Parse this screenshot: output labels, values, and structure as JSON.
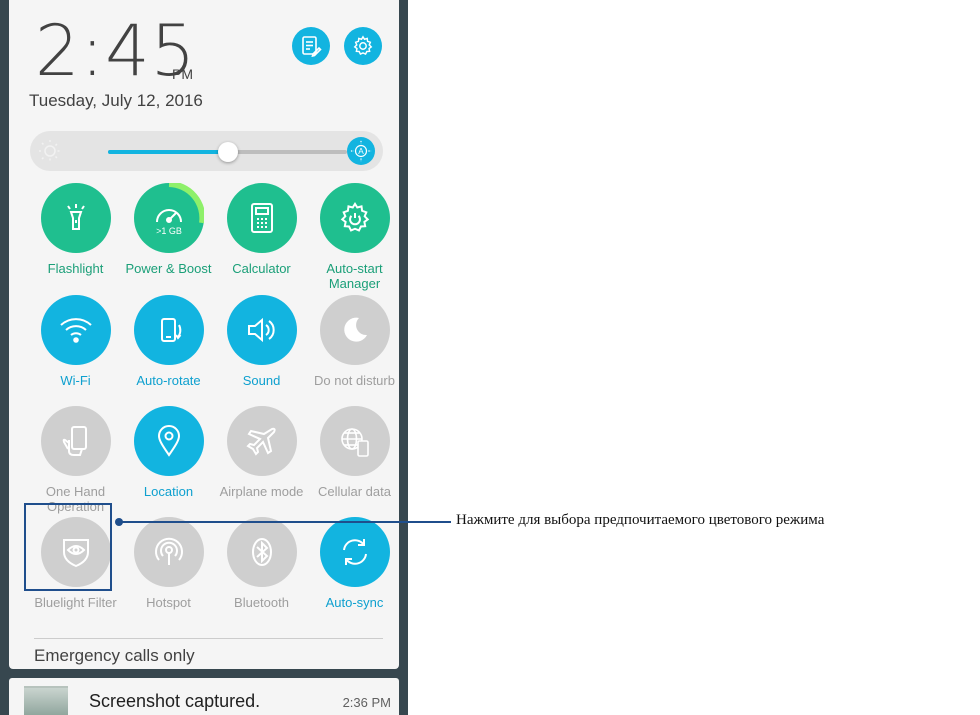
{
  "status": {
    "time": "2:45",
    "ampm": "PM",
    "date": "Tuesday, July 12, 2016"
  },
  "header_buttons": [
    {
      "icon": "notes-edit-icon"
    },
    {
      "icon": "settings-gear-icon"
    }
  ],
  "brightness": {
    "level": 0.5,
    "auto": true,
    "left_icon": "brightness-sun-icon",
    "right_icon": "auto-brightness-icon"
  },
  "tiles": [
    {
      "label": "Flashlight",
      "state": "on",
      "color": "#1fbf8f",
      "icon": "flashlight-icon"
    },
    {
      "label": "Power & Boost",
      "state": "on",
      "color": "#1fbf8f",
      "icon": "boost-speedometer-icon",
      "badge": ">1 GB"
    },
    {
      "label": "Calculator",
      "state": "on",
      "color": "#1fbf8f",
      "icon": "calculator-icon"
    },
    {
      "label": "Auto-start Manager",
      "state": "on",
      "color": "#1fbf8f",
      "icon": "gear-power-icon"
    },
    {
      "label": "Wi-Fi",
      "state": "on",
      "color": "#12b4e0",
      "icon": "wifi-icon"
    },
    {
      "label": "Auto-rotate",
      "state": "on",
      "color": "#12b4e0",
      "icon": "auto-rotate-icon"
    },
    {
      "label": "Sound",
      "state": "on",
      "color": "#12b4e0",
      "icon": "speaker-icon"
    },
    {
      "label": "Do not disturb",
      "state": "off",
      "color": "#cfcfcf",
      "icon": "moon-icon"
    },
    {
      "label": "One Hand Operation",
      "state": "off",
      "color": "#cfcfcf",
      "icon": "one-hand-icon"
    },
    {
      "label": "Location",
      "state": "on",
      "color": "#12b4e0",
      "icon": "location-pin-icon"
    },
    {
      "label": "Airplane mode",
      "state": "off",
      "color": "#cfcfcf",
      "icon": "airplane-icon"
    },
    {
      "label": "Cellular data",
      "state": "off",
      "color": "#cfcfcf",
      "icon": "globe-phone-icon"
    },
    {
      "label": "Bluelight Filter",
      "state": "off",
      "color": "#cfcfcf",
      "icon": "eye-shield-icon"
    },
    {
      "label": "Hotspot",
      "state": "off",
      "color": "#cfcfcf",
      "icon": "hotspot-icon"
    },
    {
      "label": "Bluetooth",
      "state": "off",
      "color": "#cfcfcf",
      "icon": "bluetooth-icon"
    },
    {
      "label": "Auto-sync",
      "state": "on",
      "color": "#12b4e0",
      "icon": "sync-icon"
    }
  ],
  "footer": {
    "emergency": "Emergency calls only"
  },
  "notification": {
    "title": "Screenshot captured.",
    "time": "2:36 PM"
  },
  "callout": {
    "text": "Нажмите для выбора предпочитаемого цветового режима"
  }
}
